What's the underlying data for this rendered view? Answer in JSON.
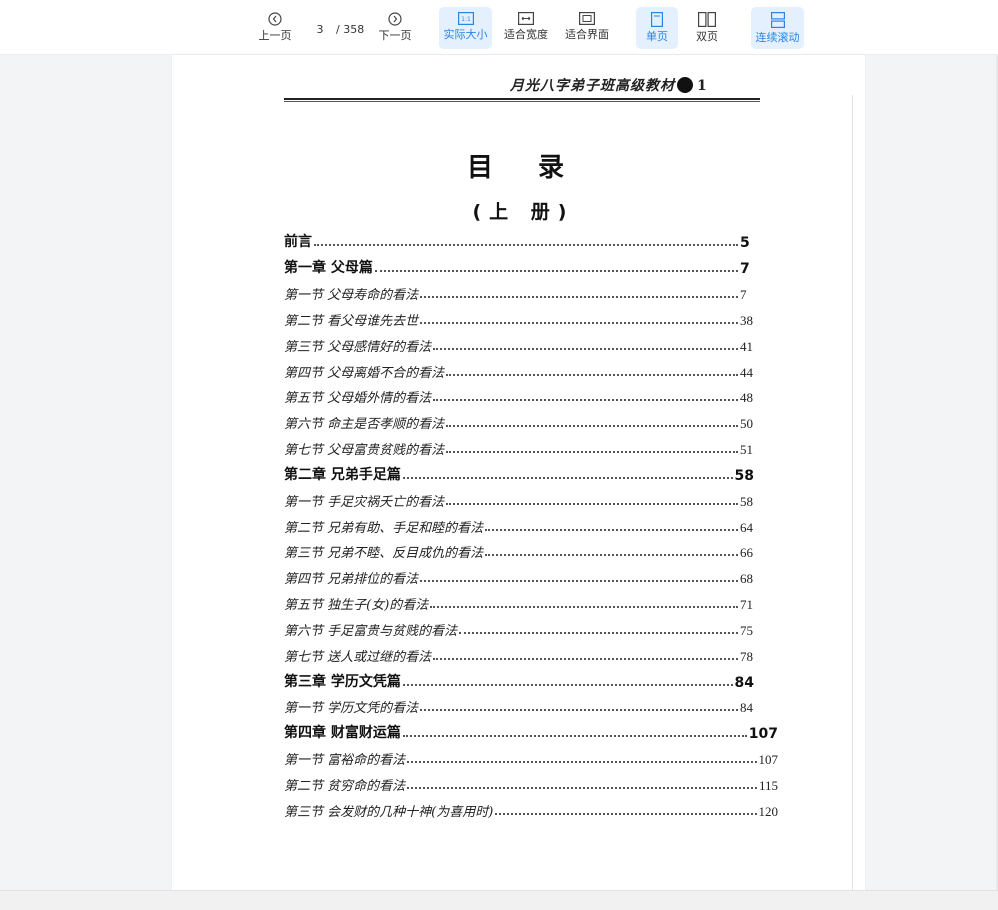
{
  "toolbar": {
    "prev_label": "上一页",
    "current_page": "3",
    "total_pages": "/ 358",
    "next_label": "下一页",
    "actual_size_label": "实际大小",
    "actual_size_icon_text": "1:1",
    "fit_width_label": "适合宽度",
    "fit_page_label": "适合界面",
    "single_page_label": "单页",
    "double_page_label": "双页",
    "continuous_label": "连续滚动",
    "accent_color": "#2a84e6",
    "active_bg": "#e4f0fd"
  },
  "document": {
    "header_text": "月光八字弟子班高级教材",
    "header_page": "1",
    "title": "目 录",
    "subtitle": "(上 册)",
    "entries": [
      {
        "kind": "chapter",
        "text": "前言",
        "page": "5"
      },
      {
        "kind": "chapter",
        "text": "第一章  父母篇",
        "page": "7"
      },
      {
        "kind": "section",
        "text": "第一节  父母寿命的看法",
        "page": "7"
      },
      {
        "kind": "section",
        "text": "第二节  看父母谁先去世",
        "page": "38"
      },
      {
        "kind": "section",
        "text": "第三节  父母感情好的看法",
        "page": "41"
      },
      {
        "kind": "section",
        "text": "第四节  父母离婚不合的看法",
        "page": "44"
      },
      {
        "kind": "section",
        "text": "第五节  父母婚外情的看法",
        "page": "48"
      },
      {
        "kind": "section",
        "text": "第六节  命主是否孝顺的看法",
        "page": "50"
      },
      {
        "kind": "section",
        "text": "第七节  父母富贵贫贱的看法",
        "page": "51"
      },
      {
        "kind": "chapter",
        "text": "第二章  兄弟手足篇",
        "page": "58"
      },
      {
        "kind": "section",
        "text": "第一节  手足灾祸夭亡的看法",
        "page": "58"
      },
      {
        "kind": "section",
        "text": "第二节  兄弟有助、手足和睦的看法",
        "page": "64"
      },
      {
        "kind": "section",
        "text": "第三节  兄弟不睦、反目成仇的看法",
        "page": "66"
      },
      {
        "kind": "section",
        "text": "第四节  兄弟排位的看法",
        "page": "68"
      },
      {
        "kind": "section",
        "text": "第五节  独生子(女)的看法",
        "page": "71"
      },
      {
        "kind": "section",
        "text": "第六节  手足富贵与贫贱的看法",
        "page": "75"
      },
      {
        "kind": "section",
        "text": "第七节  送人或过继的看法",
        "page": "78"
      },
      {
        "kind": "chapter",
        "text": "第三章  学历文凭篇",
        "page": "84"
      },
      {
        "kind": "section",
        "text": "第一节  学历文凭的看法",
        "page": "84"
      },
      {
        "kind": "chapter",
        "text": "第四章  财富财运篇",
        "page": "107"
      },
      {
        "kind": "section",
        "text": "第一节  富裕命的看法",
        "page": "107"
      },
      {
        "kind": "section",
        "text": "第二节  贫穷命的看法",
        "page": "115"
      },
      {
        "kind": "section",
        "text": "第三节  会发财的几种十神(为喜用时)",
        "page": "120"
      }
    ]
  }
}
